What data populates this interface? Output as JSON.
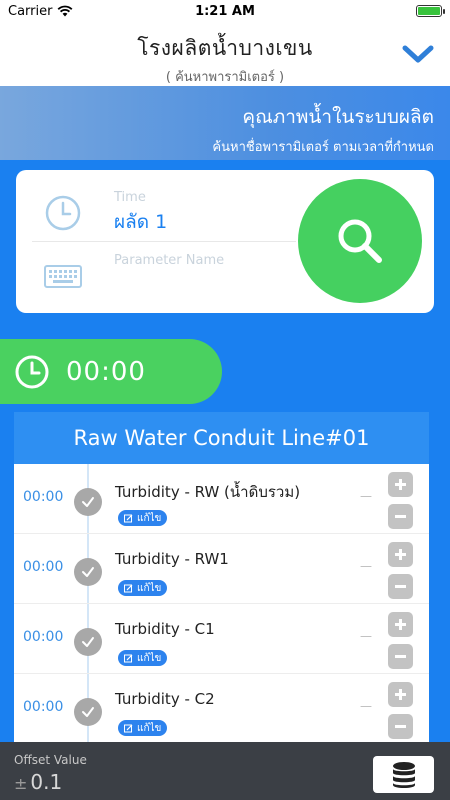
{
  "status_bar": {
    "carrier": "Carrier",
    "time": "1:21 AM",
    "battery_color": "#38c33c"
  },
  "nav": {
    "title": "โรงผลิตน้ำบางเขน",
    "subtitle": "( ค้นหาพารามิเตอร์ )",
    "chevron_icon": "chevron-down-icon"
  },
  "band": {
    "title": "คุณภาพน้ำในระบบผลิต",
    "subtitle": "ค้นหาชื่อพารามิเตอร์ ตามเวลาที่กำหนด"
  },
  "search": {
    "time_label": "Time",
    "time_value": "ผลัด 1",
    "parameter_placeholder": "Parameter Name",
    "search_icon": "search-icon",
    "button_color": "#45d060"
  },
  "time_selector": {
    "value": "00:00",
    "icon": "clock-icon"
  },
  "list": {
    "header": "Raw Water Conduit Line#01",
    "items": [
      {
        "time": "00:00",
        "name": "Turbidity - RW (น้ำดิบรวม)",
        "edit_label": "แก้ไข",
        "value": "—"
      },
      {
        "time": "00:00",
        "name": "Turbidity - RW1",
        "edit_label": "แก้ไข",
        "value": "—"
      },
      {
        "time": "00:00",
        "name": "Turbidity - C1",
        "edit_label": "แก้ไข",
        "value": "—"
      },
      {
        "time": "00:00",
        "name": "Turbidity - C2",
        "edit_label": "แก้ไข",
        "value": "—"
      }
    ]
  },
  "bottom": {
    "offset_label": "Offset Value",
    "offset_sign": "±",
    "offset_value": "0.1",
    "database_icon": "database-icon"
  },
  "colors": {
    "primary": "#1a80f0",
    "accent_green": "#4ad160",
    "bottom_bar": "#3b3f45"
  }
}
